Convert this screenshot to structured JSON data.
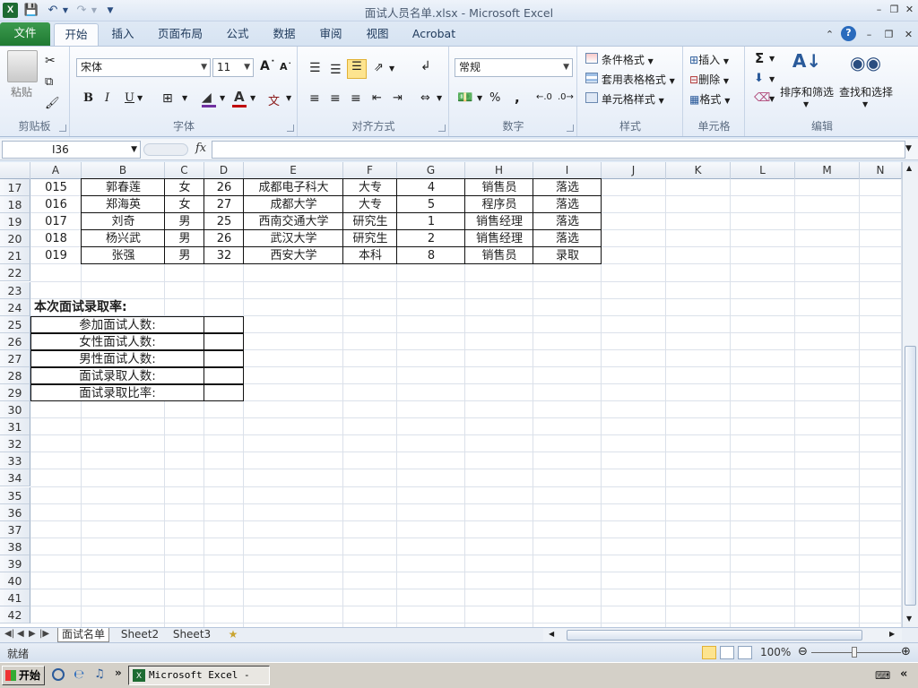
{
  "window": {
    "title": "面试人员名单.xlsx  -  Microsoft Excel",
    "logo": "X"
  },
  "ribbon_tabs": [
    "文件",
    "开始",
    "插入",
    "页面布局",
    "公式",
    "数据",
    "审阅",
    "视图",
    "Acrobat"
  ],
  "ribbon": {
    "clipboard": {
      "label": "剪贴板",
      "paste": "粘贴"
    },
    "font": {
      "label": "字体",
      "name": "宋体",
      "size": "11",
      "bold": "B",
      "italic": "I",
      "underline": "U"
    },
    "alignment": {
      "label": "对齐方式"
    },
    "number": {
      "label": "数字",
      "format": "常规",
      "percent": "%",
      "comma": ","
    },
    "styles": {
      "label": "样式",
      "conditional": "条件格式",
      "table": "套用表格格式",
      "cell_styles": "单元格样式"
    },
    "cells": {
      "label": "单元格",
      "insert": "插入",
      "delete": "删除",
      "format": "格式"
    },
    "editing": {
      "label": "编辑",
      "sigma": "Σ",
      "sort": "排序和筛选",
      "find": "查找和选择"
    }
  },
  "formula_bar": {
    "name_box": "I36",
    "fx": "fx",
    "formula": ""
  },
  "columns": [
    "A",
    "B",
    "C",
    "D",
    "E",
    "F",
    "G",
    "H",
    "I",
    "J",
    "K",
    "L",
    "M",
    "N"
  ],
  "rows": [
    "17",
    "18",
    "19",
    "20",
    "21",
    "22",
    "23",
    "24",
    "25",
    "26",
    "27",
    "28",
    "29",
    "30",
    "31",
    "32",
    "33",
    "34",
    "35",
    "36",
    "37",
    "38",
    "39",
    "40",
    "41",
    "42"
  ],
  "table_rows": [
    [
      "015",
      "郭春莲",
      "女",
      "26",
      "成都电子科大",
      "大专",
      "4",
      "销售员",
      "落选"
    ],
    [
      "016",
      "郑海英",
      "女",
      "27",
      "成都大学",
      "大专",
      "5",
      "程序员",
      "落选"
    ],
    [
      "017",
      "刘奇",
      "男",
      "25",
      "西南交通大学",
      "研究生",
      "1",
      "销售经理",
      "落选"
    ],
    [
      "018",
      "杨兴武",
      "男",
      "26",
      "武汉大学",
      "研究生",
      "2",
      "销售经理",
      "落选"
    ],
    [
      "019",
      "张强",
      "男",
      "32",
      "西安大学",
      "本科",
      "8",
      "销售员",
      "录取"
    ]
  ],
  "summary": {
    "title": "本次面试录取率:",
    "labels": [
      "参加面试人数:",
      "女性面试人数:",
      "男性面试人数:",
      "面试录取人数:",
      "面试录取比率:"
    ]
  },
  "sheet_tabs": [
    "面试名单",
    "Sheet2",
    "Sheet3"
  ],
  "status": {
    "ready": "就绪",
    "zoom": "100%"
  },
  "taskbar": {
    "start": "开始",
    "task": "Microsoft Excel - ..."
  }
}
